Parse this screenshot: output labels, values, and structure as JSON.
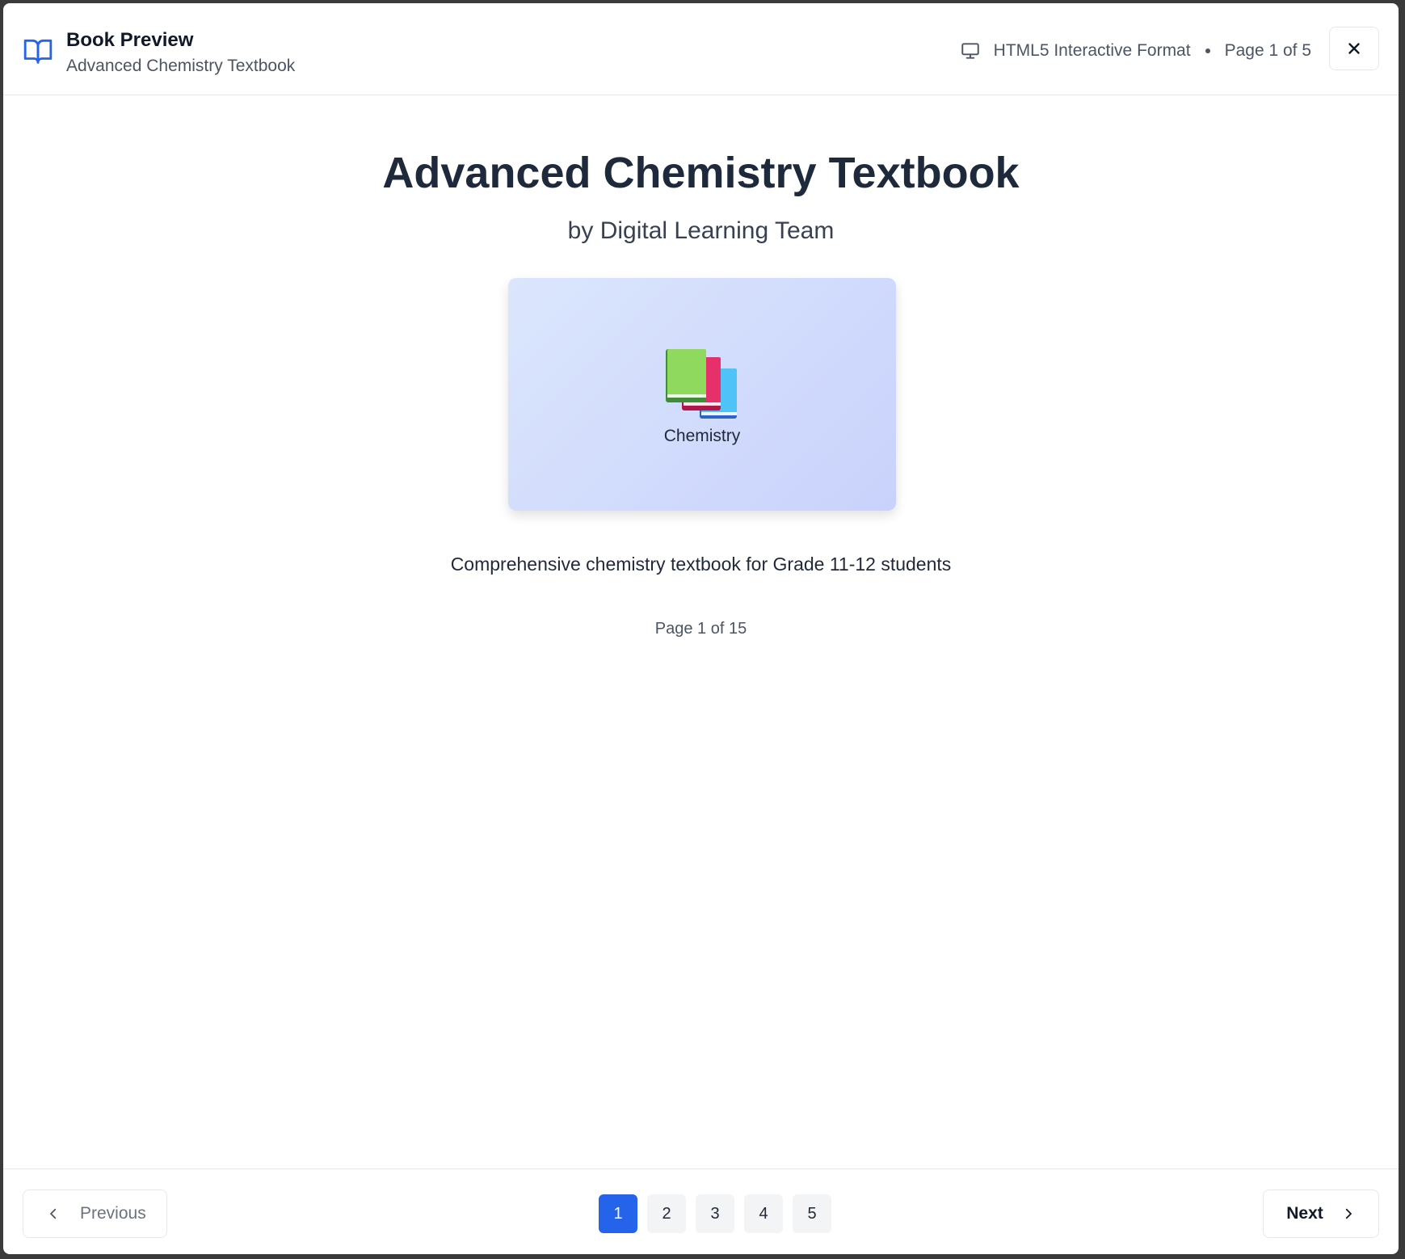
{
  "header": {
    "title": "Book Preview",
    "subtitle": "Advanced Chemistry Textbook",
    "format_label": "HTML5 Interactive Format",
    "page_status": "Page 1 of 5",
    "icons": {
      "book": "book-open-icon",
      "format": "monitor-icon",
      "close": "close-icon"
    }
  },
  "book": {
    "title": "Advanced Chemistry Textbook",
    "author": "by Digital Learning Team",
    "cover_label": "Chemistry",
    "cover_icon": "books-icon",
    "description": "Comprehensive chemistry textbook for Grade 11-12 students",
    "page_indicator": "Page 1 of 15"
  },
  "footer": {
    "previous_label": "Previous",
    "next_label": "Next",
    "pages": [
      "1",
      "2",
      "3",
      "4",
      "5"
    ],
    "active_page": "1"
  },
  "colors": {
    "accent": "#2563eb",
    "cover_gradient_start": "#dbe6fd",
    "cover_gradient_end": "#c9d2fb"
  }
}
